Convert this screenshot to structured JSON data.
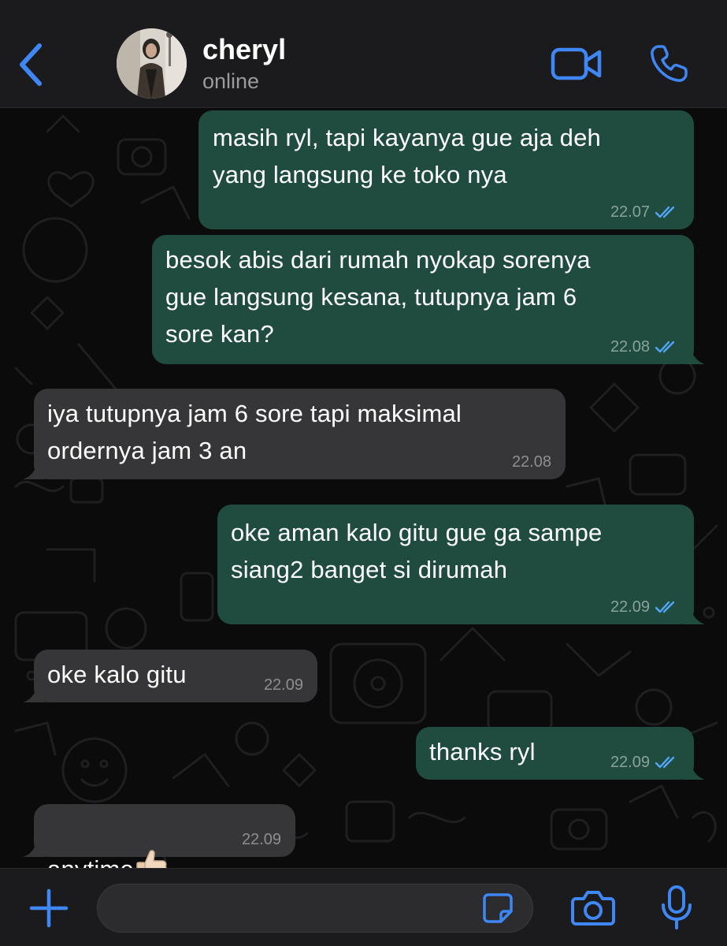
{
  "header": {
    "contact_name": "cheryl",
    "contact_status": "online",
    "back_icon": "chevron-left-icon",
    "video_icon": "video-camera-icon",
    "call_icon": "phone-icon"
  },
  "colors": {
    "accent": "#3f87f5",
    "outgoing_bubble": "#1f4c3f",
    "incoming_bubble": "#363638",
    "read_ticks": "#53a6fa"
  },
  "messages": [
    {
      "direction": "out",
      "text": "masih ryl, tapi kayanya gue aja deh\nyang langsung ke toko nya",
      "time": "22.07",
      "status": "read"
    },
    {
      "direction": "out",
      "text": "besok abis dari rumah nyokap sorenya\ngue langsung kesana, tutupnya jam 6\nsore kan?",
      "time": "22.08",
      "status": "read"
    },
    {
      "direction": "in",
      "text": "iya tutupnya jam 6 sore tapi maksimal\nordernya jam 3 an",
      "time": "22.08"
    },
    {
      "direction": "out",
      "text": "oke aman kalo gitu gue ga sampe\nsiang2 banget si dirumah",
      "time": "22.09",
      "status": "read"
    },
    {
      "direction": "in",
      "text": "oke kalo gitu",
      "time": "22.09"
    },
    {
      "direction": "out",
      "text": "thanks ryl",
      "time": "22.09",
      "status": "read"
    },
    {
      "direction": "in",
      "text": "anytime",
      "emoji": "thumbs-up-emoji",
      "time": "22.09"
    }
  ],
  "composer": {
    "value": "",
    "plus_icon": "plus-icon",
    "sticker_icon": "sticker-icon",
    "camera_icon": "camera-icon",
    "mic_icon": "microphone-icon"
  }
}
